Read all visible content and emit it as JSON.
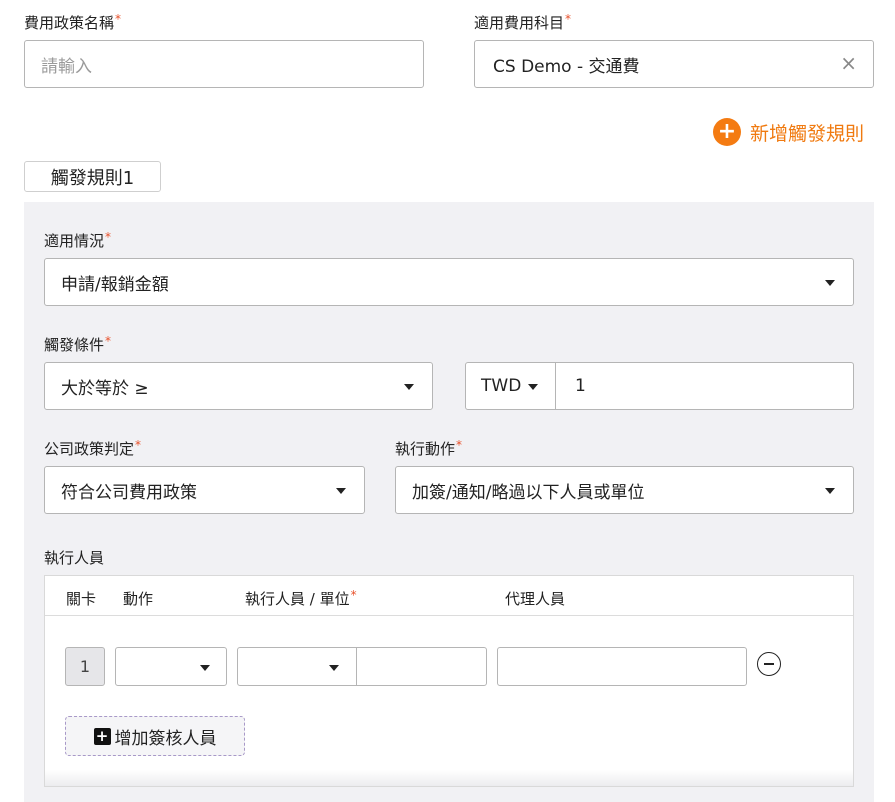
{
  "policy_name": {
    "label": "費用政策名稱",
    "required_mark": "*",
    "placeholder": "請輸入"
  },
  "expense_category": {
    "label": "適用費用科目",
    "required_mark": "*",
    "value": "CS Demo - 交通費",
    "clear_glyph": "×"
  },
  "add_trigger_rule": {
    "label": "新增觸發規則",
    "glyph": "+"
  },
  "rule_tab": {
    "label": "觸發規則1"
  },
  "rule": {
    "applicable_case": {
      "label": "適用情況",
      "required_mark": "*",
      "value": "申請/報銷金額"
    },
    "trigger_condition": {
      "label": "觸發條件",
      "required_mark": "*",
      "operator": "大於等於 ≥",
      "currency": "TWD",
      "amount": "1"
    },
    "policy_judgement": {
      "label": "公司政策判定",
      "required_mark": "*",
      "value": "符合公司費用政策"
    },
    "action": {
      "label": "執行動作",
      "required_mark": "*",
      "value": "加簽/通知/略過以下人員或單位"
    },
    "executors": {
      "label": "執行人員",
      "columns": {
        "stage": "關卡",
        "action": "動作",
        "executor": "執行人員 / 單位",
        "executor_required_mark": "*",
        "delegate": "代理人員"
      },
      "rows": [
        {
          "stage": "1",
          "action": "",
          "executor_type": "",
          "executor": "",
          "delegate": ""
        }
      ],
      "add_approver": {
        "label": "增加簽核人員",
        "glyph": "+"
      }
    }
  }
}
